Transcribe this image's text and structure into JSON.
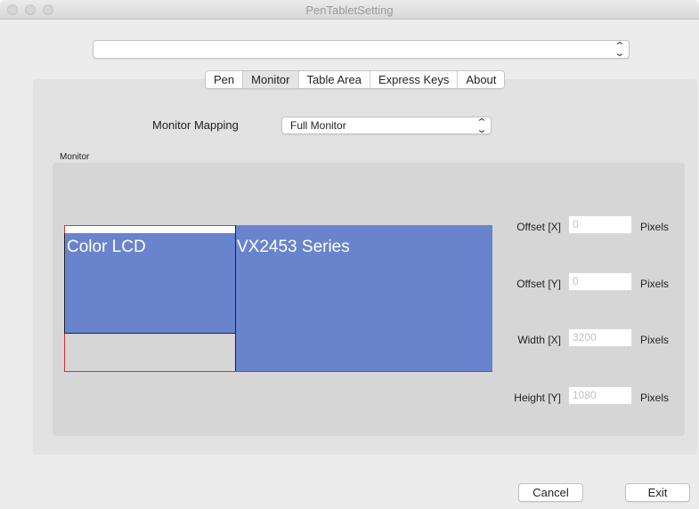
{
  "window": {
    "title": "PenTabletSetting"
  },
  "device_select": {
    "value": ""
  },
  "tabs": [
    {
      "label": "Pen",
      "active": false
    },
    {
      "label": "Monitor",
      "active": true
    },
    {
      "label": "Table Area",
      "active": false
    },
    {
      "label": "Express Keys",
      "active": false
    },
    {
      "label": "About",
      "active": false
    }
  ],
  "monitor_mapping": {
    "label": "Monitor Mapping",
    "value": "Full Monitor"
  },
  "monitor_group": {
    "label": "Monitor"
  },
  "monitors": [
    {
      "name": "Color LCD"
    },
    {
      "name": "VX2453 Series"
    }
  ],
  "fields": {
    "offset_x": {
      "label": "Offset [X]",
      "value": "0",
      "unit": "Pixels"
    },
    "offset_y": {
      "label": "Offset [Y]",
      "value": "0",
      "unit": "Pixels"
    },
    "width_x": {
      "label": "Width [X]",
      "value": "3200",
      "unit": "Pixels"
    },
    "height_y": {
      "label": "Height [Y]",
      "value": "1080",
      "unit": "Pixels"
    }
  },
  "buttons": {
    "cancel": "Cancel",
    "exit": "Exit"
  },
  "colors": {
    "monitor_fill": "#6984cd",
    "selection_outline": "#d9312f",
    "panel_bg": "#e2e2e2",
    "group_bg": "#d6d6d6"
  }
}
